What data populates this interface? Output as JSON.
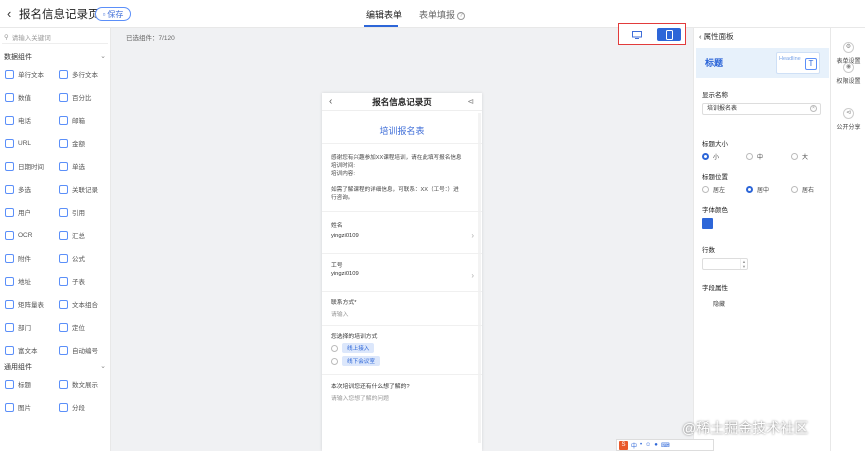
{
  "header": {
    "title": "报名信息记录页",
    "save_label": "保存",
    "tabs": [
      "编辑表单",
      "表单填报"
    ]
  },
  "left_panel": {
    "search_placeholder": "请输入关键词",
    "data_group_title": "数据组件",
    "data_components": [
      [
        "单行文本",
        "多行文本"
      ],
      [
        "数值",
        "百分比"
      ],
      [
        "电话",
        "邮箱"
      ],
      [
        "URL",
        "金额"
      ],
      [
        "日期时间",
        "单选"
      ],
      [
        "多选",
        "关联记录"
      ],
      [
        "用户",
        "引用"
      ],
      [
        "OCR",
        "汇总"
      ],
      [
        "附件",
        "公式"
      ],
      [
        "地址",
        "子表"
      ],
      [
        "矩阵量表",
        "文本组合"
      ],
      [
        "部门",
        "定位"
      ],
      [
        "富文本",
        "自动编号"
      ]
    ],
    "general_group_title": "通用组件",
    "general_components": [
      [
        "标题",
        "数文展示"
      ],
      [
        "图片",
        "分段"
      ]
    ]
  },
  "canvas": {
    "selected_count": "已选组件：7/120"
  },
  "phone": {
    "title": "报名信息记录页",
    "form_title": "培训报名表",
    "desc_line1": "感谢您有兴趣参加XX课程培训，请在此填写报名信息",
    "desc_line2": "培训时间:",
    "desc_line3": "培训内容:",
    "desc_line4": "如需了解课程的详细信息，可联系：XX（工号：）进",
    "desc_line5": "行咨询。",
    "f1_label": "姓名",
    "f1_value": "yingzi0109",
    "f2_label": "工号",
    "f2_value": "yingzi0109",
    "f3_label": "联系方式*",
    "f3_placeholder": "请输入",
    "f4_label": "您选择的培训方式",
    "f4_opt1": "线上接入",
    "f4_opt2": "线下会议室",
    "f5_label": "本次培训您还有什么想了解的?",
    "f5_placeholder": "请输入您想了解的问题"
  },
  "properties": {
    "panel_title": "属性面板",
    "banner_label": "标题",
    "banner_art_text": "Headline",
    "display_name_label": "显示名称",
    "display_name_value": "培训报名表",
    "title_size_label": "标题大小",
    "size_options": [
      "小",
      "中",
      "大"
    ],
    "size_selected": "小",
    "title_pos_label": "标题位置",
    "pos_options": [
      "居左",
      "居中",
      "居右"
    ],
    "pos_selected": "居中",
    "font_color_label": "字体颜色",
    "font_color": "#2d66d8",
    "rows_label": "行数",
    "field_attr_label": "字段属性",
    "hide_label": "隐藏"
  },
  "right_rail": {
    "items": [
      "表单设置",
      "权限设置",
      "公开分享"
    ]
  },
  "watermark": "@稀土掘金技术社区",
  "ime": "中"
}
